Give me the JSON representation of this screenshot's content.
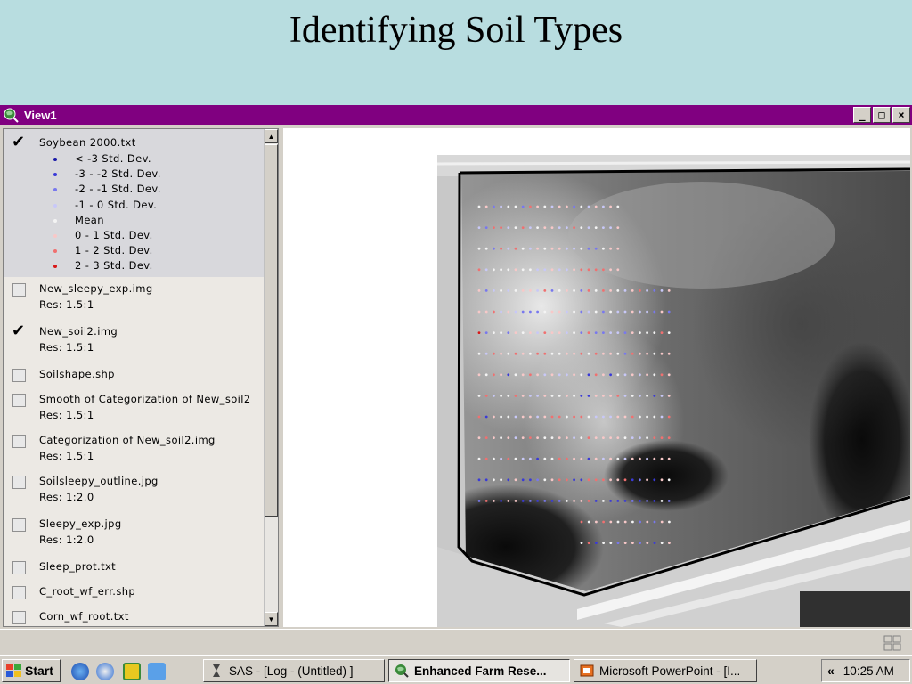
{
  "slide": {
    "title": "Identifying Soil Types"
  },
  "window": {
    "title": "View1",
    "buttons": {
      "minimize": "_",
      "maximize": "□",
      "close": "×"
    }
  },
  "legend_classes": [
    {
      "label": "< -3 Std. Dev.",
      "color": "#1a1aa8"
    },
    {
      "label": "-3 - -2 Std. Dev.",
      "color": "#3a3ad8"
    },
    {
      "label": "-2 - -1 Std. Dev.",
      "color": "#7878ee"
    },
    {
      "label": "-1 - 0 Std. Dev.",
      "color": "#c8c8f8"
    },
    {
      "label": "Mean",
      "color": "#f4f4f4"
    },
    {
      "label": "0 - 1 Std. Dev.",
      "color": "#f8c8c8"
    },
    {
      "label": "1 - 2 Std. Dev.",
      "color": "#f07070"
    },
    {
      "label": "2 - 3 Std. Dev.",
      "color": "#d81818"
    }
  ],
  "layers": [
    {
      "name": "Soybean 2000.txt",
      "res": "",
      "checked": true
    },
    {
      "name": "New_sleepy_exp.img",
      "res": "Res: 1.5:1",
      "checked": false
    },
    {
      "name": "New_soil2.img",
      "res": "Res: 1.5:1",
      "checked": true
    },
    {
      "name": "Soilshape.shp",
      "res": "",
      "checked": false
    },
    {
      "name": "Smooth of Categorization of New_soil2",
      "res": "Res: 1.5:1",
      "checked": false
    },
    {
      "name": "Categorization of New_soil2.img",
      "res": "Res: 1.5:1",
      "checked": false
    },
    {
      "name": "Soilsleepy_outline.jpg",
      "res": "Res: 1:2.0",
      "checked": false
    },
    {
      "name": "Sleepy_exp.jpg",
      "res": "Res: 1:2.0",
      "checked": false
    },
    {
      "name": "Sleep_prot.txt",
      "res": "",
      "checked": false
    },
    {
      "name": "C_root_wf_err.shp",
      "res": "",
      "checked": false
    },
    {
      "name": "Corn_wf_root.txt",
      "res": "",
      "checked": false
    }
  ],
  "taskbar": {
    "start_label": "Start",
    "tasks": [
      {
        "label": "SAS - [Log - (Untitled) ]",
        "active": false,
        "icon": "sas-hourglass-icon"
      },
      {
        "label": "Enhanced Farm Rese...",
        "active": true,
        "icon": "arcview-globe-icon"
      },
      {
        "label": "Microsoft PowerPoint - [I...",
        "active": false,
        "icon": "powerpoint-icon"
      }
    ],
    "tray_chevron": "«",
    "clock": "10:25 AM"
  },
  "colors": {
    "title_bar": "#800080",
    "slide_background": "#b8dde0",
    "field_outline": "#000000"
  }
}
